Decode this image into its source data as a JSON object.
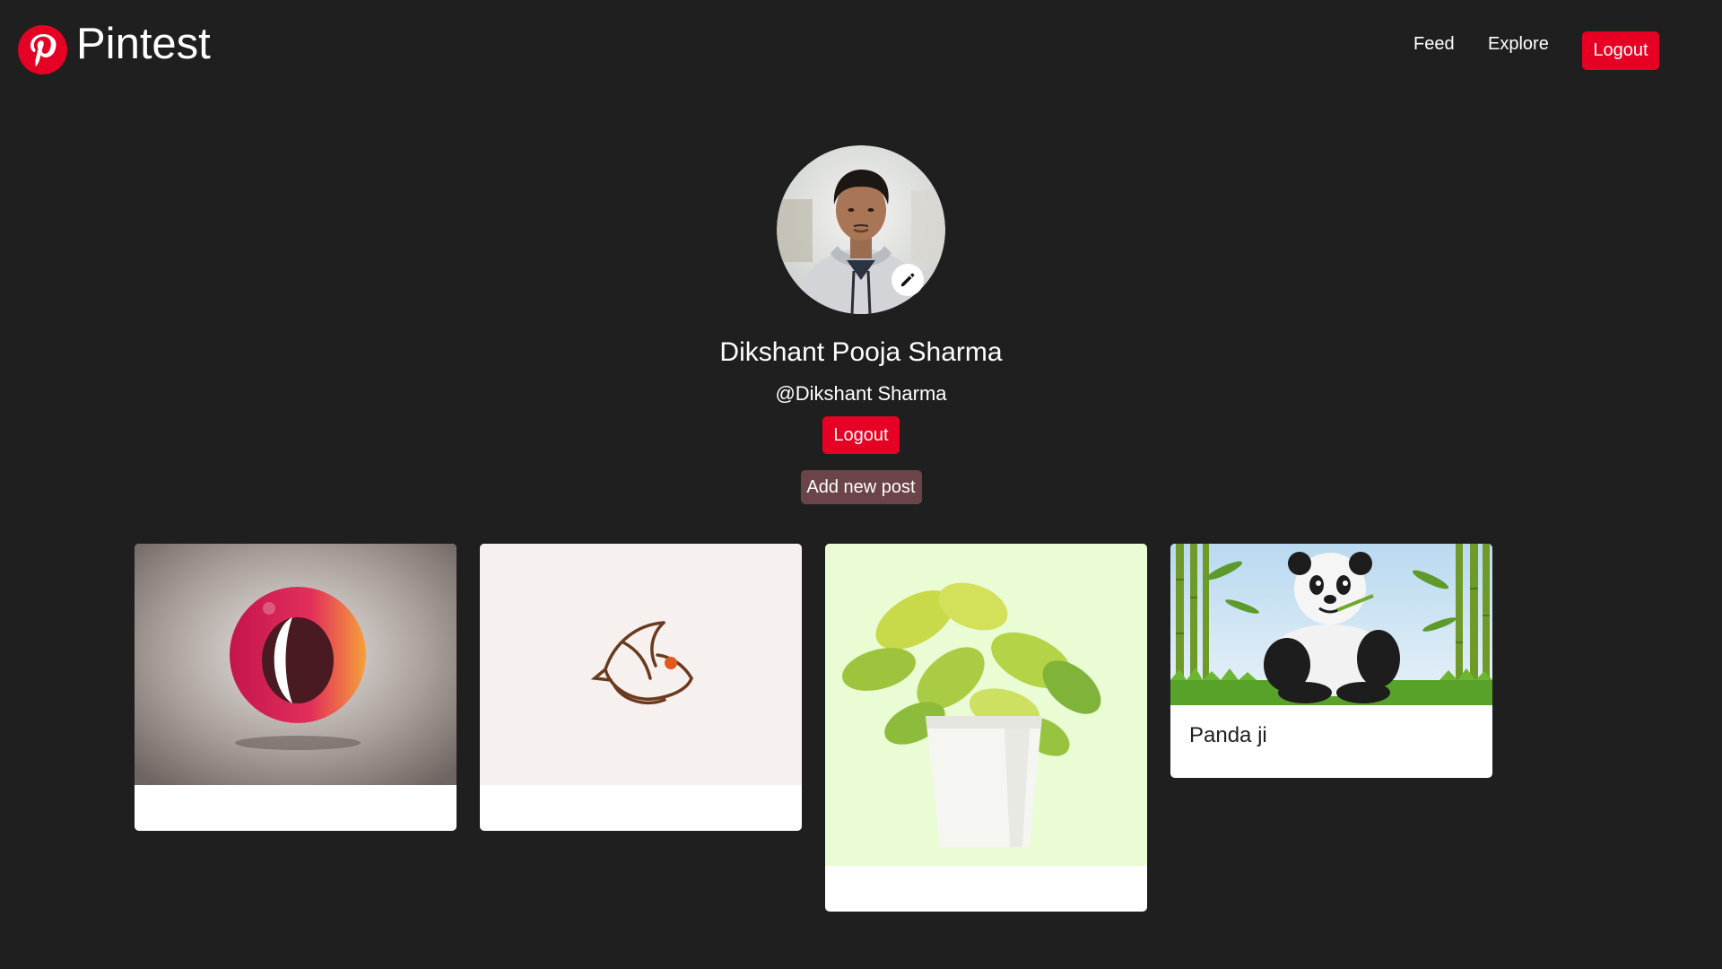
{
  "brand": {
    "name": "Pintest",
    "logo_icon": "pinterest-logo-icon",
    "accent": "#e60023"
  },
  "nav": {
    "feed": "Feed",
    "explore": "Explore",
    "logout": "Logout"
  },
  "profile": {
    "name": "Dikshant Pooja Sharma",
    "handle": "@Dikshant Sharma",
    "logout": "Logout",
    "add_post": "Add new post",
    "edit_icon": "pencil-icon"
  },
  "posts": [
    {
      "title": "",
      "image": "red-sphere-logo"
    },
    {
      "title": "",
      "image": "bird-line-logo"
    },
    {
      "title": "",
      "image": "potted-plant"
    },
    {
      "title": "Panda ji",
      "image": "panda-bamboo"
    }
  ],
  "colors": {
    "background": "#201f20",
    "primary_button": "#e60023",
    "secondary_button": "#6b4449"
  }
}
